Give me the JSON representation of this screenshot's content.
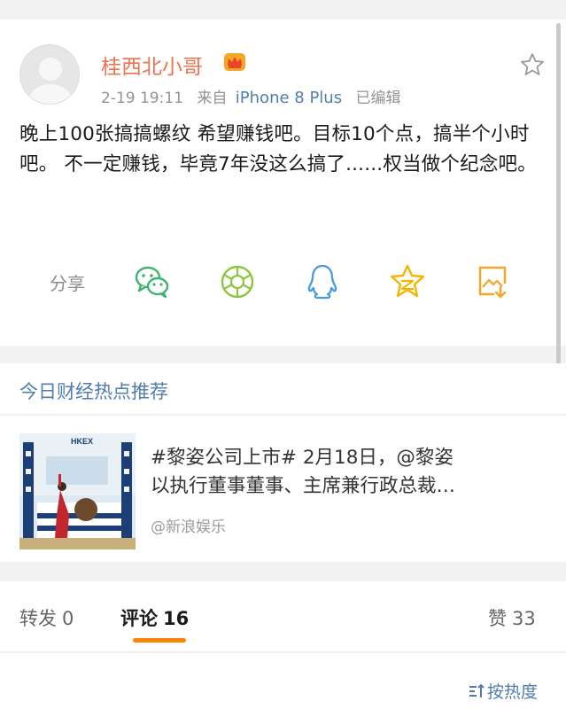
{
  "post": {
    "username": "桂西北小哥",
    "time": "2-19 19:11",
    "source_prefix": "来自",
    "device": "iPhone 8 Plus",
    "edited": "已编辑",
    "text": "晚上100张搞搞螺纹 希望赚钱吧。目标10个点，搞半个小时吧。 不一定赚钱，毕竟7年没这么搞了......权当做个纪念吧。",
    "share_label": "分享",
    "share_targets": [
      "wechat-icon",
      "moments-icon",
      "qq-icon",
      "qzone-icon",
      "save-image-icon"
    ]
  },
  "hot": {
    "title": "今日财经热点推荐",
    "line1": "#黎姿公司上市# 2月18日，@黎姿",
    "line2": "以执行董事董事、主席兼行政总裁…",
    "source": "@新浪娱乐",
    "thumb_logo": "HKEX"
  },
  "tabs": {
    "repost_label": "转发",
    "repost_count": "0",
    "comment_label": "评论",
    "comment_count": "16",
    "like_label": "赞",
    "like_count": "33"
  },
  "sort": {
    "label": "按热度"
  },
  "colors": {
    "username": "#eb7350",
    "link": "#507daf",
    "accent": "#ff8200",
    "wechat": "#3cb371",
    "moments": "#8cc63f",
    "qq": "#4a9be0",
    "qzone": "#f5b400",
    "save": "#f5a623"
  }
}
